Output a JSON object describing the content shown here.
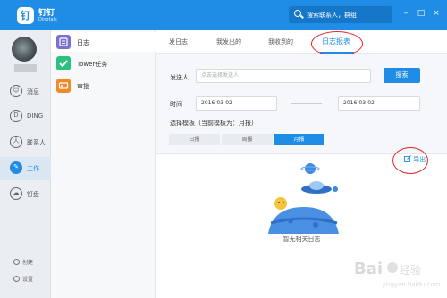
{
  "app": {
    "logo_glyph": "钉",
    "name": "钉钉",
    "subtitle": "Dingtalk"
  },
  "search": {
    "placeholder": "搜索联系人，群组"
  },
  "window": {
    "minimize": "–",
    "maximize": "□",
    "close": "×"
  },
  "nav": {
    "items": [
      {
        "label": "消息",
        "icon": "message-icon",
        "glyph": "☺"
      },
      {
        "label": "DING",
        "icon": "ding-icon",
        "glyph": "D"
      },
      {
        "label": "联系人",
        "icon": "contacts-icon",
        "glyph": "人"
      },
      {
        "label": "工作",
        "icon": "work-icon",
        "glyph": "✎",
        "active": true
      },
      {
        "label": "钉盘",
        "icon": "cloud-disk-icon",
        "glyph": "☁"
      }
    ],
    "bottom": [
      {
        "label": "创建",
        "icon": "create-icon"
      },
      {
        "label": "设置",
        "icon": "settings-icon"
      }
    ]
  },
  "apps": [
    {
      "label": "日志",
      "icon": "log-app-icon",
      "color": "#7b6fd0",
      "active": true
    },
    {
      "label": "Tower任务",
      "icon": "tower-task-icon",
      "color": "#2cbf7d"
    },
    {
      "label": "审批",
      "icon": "approval-icon",
      "color": "#f08a2b"
    }
  ],
  "tabs": [
    "发日志",
    "我发出的",
    "我收到的",
    "日志报表"
  ],
  "active_tab": "日志报表",
  "form": {
    "sender_label": "发送人",
    "sender_placeholder": "点击选择发送人",
    "search_button": "搜索",
    "time_label": "时间",
    "start_date": "2016-03-02",
    "end_date": "2016-03-02",
    "template_label": "选择模板（当前模板为：月报）",
    "templates": [
      "日报",
      "周报",
      "月报"
    ],
    "selected_template": "月报"
  },
  "export": {
    "label": "导出"
  },
  "empty": {
    "text": "暂无相关日志"
  },
  "watermark": {
    "text": "Baidu 经验",
    "sub": "jingyan.baidu.com"
  },
  "colors": {
    "brand": "#1f8ce6",
    "highlight_ring": "#e2262b"
  }
}
